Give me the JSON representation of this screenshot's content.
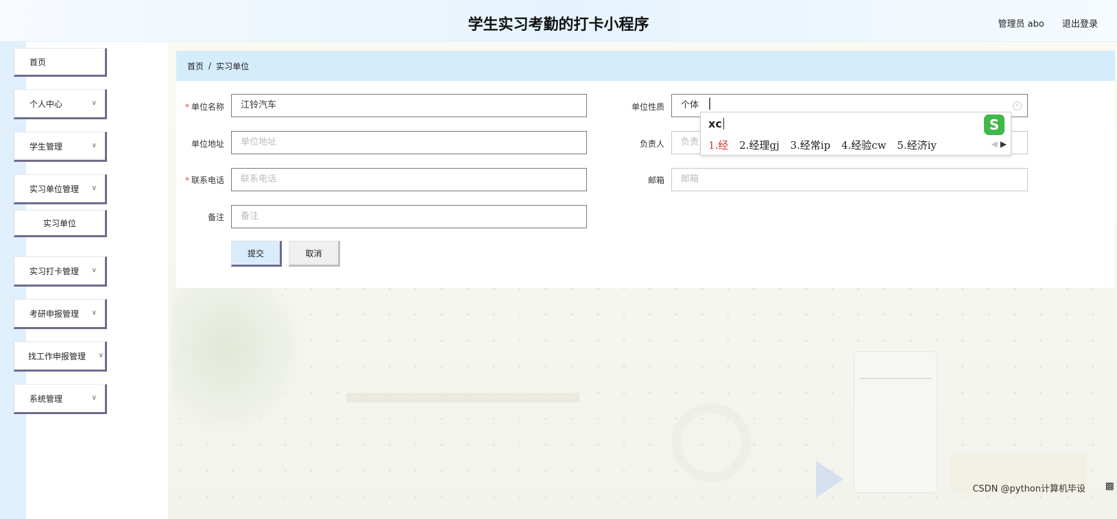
{
  "header": {
    "title": "学生实习考勤的打卡小程序",
    "user_label": "管理员 abo",
    "logout_label": "退出登录"
  },
  "sidebar": {
    "items": [
      {
        "label": "首页",
        "chevron": false
      },
      {
        "label": "个人中心",
        "chevron": true
      },
      {
        "label": "学生管理",
        "chevron": true
      },
      {
        "label": "实习单位管理",
        "chevron": true
      },
      {
        "label": "实习单位",
        "chevron": false,
        "sub": true
      },
      {
        "label": "实习打卡管理",
        "chevron": true
      },
      {
        "label": "考研申报管理",
        "chevron": true
      },
      {
        "label": "找工作申报管理",
        "chevron": true
      },
      {
        "label": "系统管理",
        "chevron": true
      }
    ]
  },
  "breadcrumb": {
    "home": "首页",
    "separator": "/",
    "current": "实习单位"
  },
  "form": {
    "unit_name": {
      "label": "单位名称",
      "required": true,
      "value": "江铃汽车"
    },
    "unit_nature": {
      "label": "单位性质",
      "value": "个体"
    },
    "unit_address": {
      "label": "单位地址",
      "placeholder": "单位地址"
    },
    "contact_person": {
      "label": "负责人",
      "placeholder": "负责"
    },
    "phone": {
      "label": "联系电话",
      "required": true,
      "placeholder": "联系电话"
    },
    "email": {
      "label": "邮箱",
      "placeholder": "邮箱"
    },
    "remark": {
      "label": "备注",
      "placeholder": "备注"
    },
    "submit_label": "提交",
    "cancel_label": "取消"
  },
  "ime": {
    "input": "xc",
    "logo": "S",
    "candidates": [
      "1.经",
      "2.经理gj",
      "3.经常ip",
      "4.经验cw",
      "5.经济iy"
    ],
    "selected_index": 0
  },
  "footer": {
    "watermark": "CSDN @python计算机毕设"
  },
  "icons": {
    "chevron": "chevron-down-icon",
    "clear": "clear-circle-icon",
    "ime_prev": "chevron-left-icon",
    "ime_next": "chevron-right-icon"
  },
  "colors": {
    "breadcrumb_bg": "#d5ecfb",
    "menu_border": "#6d6b8c",
    "required": "#e53c3c",
    "ime_selected": "#d23a3a",
    "ime_logo": "#3fb94a"
  }
}
